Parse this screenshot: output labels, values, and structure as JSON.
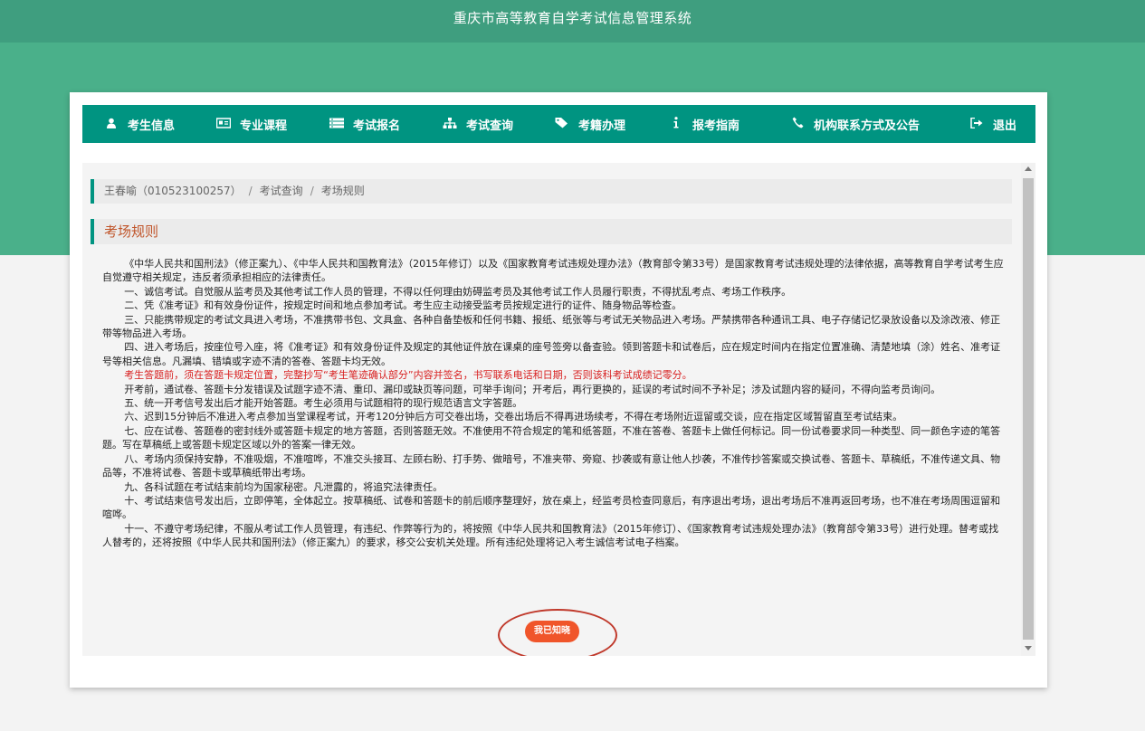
{
  "header": {
    "title": "重庆市高等教育自学考试信息管理系统"
  },
  "nav": {
    "items": [
      {
        "icon": "user-icon",
        "label": "考生信息"
      },
      {
        "icon": "id-card-icon",
        "label": "专业课程"
      },
      {
        "icon": "list-icon",
        "label": "考试报名"
      },
      {
        "icon": "sitemap-icon",
        "label": "考试查询"
      },
      {
        "icon": "tag-icon",
        "label": "考籍办理"
      },
      {
        "icon": "info-icon",
        "label": "报考指南"
      },
      {
        "icon": "phone-icon",
        "label": "机构联系方式及公告"
      },
      {
        "icon": "logout-icon",
        "label": "退出"
      }
    ]
  },
  "breadcrumb": {
    "user": "王春喻（010523100257）",
    "sep": "/",
    "level1": "考试查询",
    "level2": "考场规则"
  },
  "section": {
    "title": "考场规则"
  },
  "rules": {
    "p0": "《中华人民共和国刑法》（修正案九）、《中华人民共和国教育法》（2015年修订）以及《国家教育考试违规处理办法》（教育部令第33号）是国家教育考试违规处理的法律依据，高等教育自学考试考生应自觉遵守相关规定，违反者须承担相应的法律责任。",
    "p1": "一、诚信考试。自觉服从监考员及其他考试工作人员的管理，不得以任何理由妨碍监考员及其他考试工作人员履行职责，不得扰乱考点、考场工作秩序。",
    "p2": "二、凭《准考证》和有效身份证件，按规定时间和地点参加考试。考生应主动接受监考员按规定进行的证件、随身物品等检查。",
    "p3": "三、只能携带规定的考试文具进入考场，不准携带书包、文具盒、各种自备垫板和任何书籍、报纸、纸张等与考试无关物品进入考场。严禁携带各种通讯工具、电子存储记忆录放设备以及涂改液、修正带等物品进入考场。",
    "p4": "四、进入考场后，按座位号入座，将《准考证》和有效身份证件及规定的其他证件放在课桌的座号签旁以备查验。领到答题卡和试卷后，应在规定时间内在指定位置准确、清楚地填（涂）姓名、准考证号等相关信息。凡漏填、错填或字迹不清的答卷、答题卡均无效。",
    "p5": "考生答题前，须在答题卡规定位置，完整抄写“考生笔迹确认部分”内容并签名，书写联系电话和日期，否则该科考试成绩记零分。",
    "p6": "开考前，通试卷、答题卡分发错误及试题字迹不清、重印、漏印或缺页等问题，可举手询问；开考后，再行更换的，延误的考试时间不予补足；涉及试题内容的疑问，不得向监考员询问。",
    "p7": "五、统一开考信号发出后才能开始答题。考生必须用与试题相符的现行规范语言文字答题。",
    "p8": "六、迟到15分钟后不准进入考点参加当堂课程考试，开考120分钟后方可交卷出场，交卷出场后不得再进场续考，不得在考场附近逗留或交谈，应在指定区域暂留直至考试结束。",
    "p9": "七、应在试卷、答题卷的密封线外或答题卡规定的地方答题，否则答题无效。不准使用不符合规定的笔和纸答题，不准在答卷、答题卡上做任何标记。同一份试卷要求同一种类型、同一颜色字迹的笔答题。写在草稿纸上或答题卡规定区域以外的答案一律无效。",
    "p10": "八、考场内须保持安静，不准吸烟，不准喧哗，不准交头接耳、左顾右盼、打手势、做暗号，不准夹带、旁窥、抄袭或有意让他人抄袭，不准传抄答案或交换试卷、答题卡、草稿纸，不准传递文具、物品等，不准将试卷、答题卡或草稿纸带出考场。",
    "p11": "九、各科试题在考试结束前均为国家秘密。凡泄露的，将追究法律责任。",
    "p12": "十、考试结束信号发出后，立即停笔，全体起立。按草稿纸、试卷和答题卡的前后顺序整理好，放在桌上，经监考员检查同意后，有序退出考场，退出考场后不准再返回考场，也不准在考场周围逗留和喧哗。",
    "p13": "十一、不遵守考场纪律，不服从考试工作人员管理，有违纪、作弊等行为的，将按照《中华人民共和国教育法》（2015年修订）、《国家教育考试违规处理办法》（教育部令第33号）进行处理。替考或找人替考的，还将按照《中华人民共和国刑法》（修正案九）的要求，移交公安机关处理。所有违纪处理将记入考生诚信考试电子档案。"
  },
  "ack": {
    "label": "我已知晓"
  },
  "colors": {
    "nav": "#009481",
    "header": "#3f9e7f",
    "band": "#4ab08a",
    "accent": "#f0552a",
    "warning": "#d82020"
  }
}
